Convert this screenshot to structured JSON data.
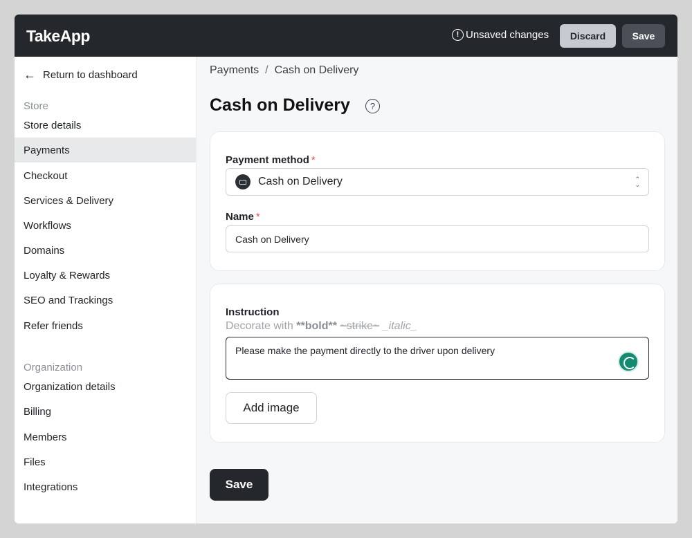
{
  "header": {
    "logo": "TakeApp",
    "unsaved_text": "Unsaved changes",
    "discard_label": "Discard",
    "save_label": "Save"
  },
  "sidebar": {
    "return_label": "Return to dashboard",
    "store_section": "Store",
    "store_items": [
      "Store details",
      "Payments",
      "Checkout",
      "Services & Delivery",
      "Workflows",
      "Domains",
      "Loyalty & Rewards",
      "SEO and Trackings",
      "Refer friends"
    ],
    "active_item": "Payments",
    "org_section": "Organization",
    "org_items": [
      "Organization details",
      "Billing",
      "Members",
      "Files",
      "Integrations"
    ]
  },
  "main": {
    "breadcrumb": [
      "Payments",
      "Cash on Delivery"
    ],
    "breadcrumb_sep": "/",
    "title": "Cash on Delivery",
    "payment_method": {
      "label": "Payment method",
      "required": "*",
      "value": "Cash on Delivery"
    },
    "name_field": {
      "label": "Name",
      "required": "*",
      "value": "Cash on Delivery"
    },
    "instruction": {
      "label": "Instruction",
      "hint_prefix": "Decorate with",
      "hint_bold": "**bold**",
      "hint_strike": "~strike~",
      "hint_italic": "_italic_",
      "value": "Please make the payment directly to the driver upon delivery"
    },
    "add_image_label": "Add image",
    "save_label": "Save"
  },
  "colors": {
    "topbar": "#24272b",
    "active_nav": "#e8e9eb",
    "required": "#d9534f",
    "grammar": "#138a72"
  }
}
